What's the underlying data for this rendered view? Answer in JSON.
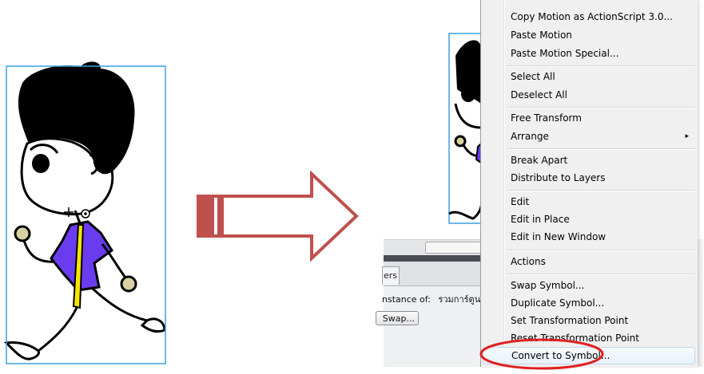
{
  "context_menu": {
    "items": [
      {
        "label": "Copy Motion as ActionScript 3.0...",
        "has_submenu": false
      },
      {
        "label": "Paste Motion",
        "has_submenu": false
      },
      {
        "label": "Paste Motion Special...",
        "has_submenu": false
      },
      {
        "label": "Select All",
        "has_submenu": false
      },
      {
        "label": "Deselect All",
        "has_submenu": false
      },
      {
        "label": "Free Transform",
        "has_submenu": false
      },
      {
        "label": "Arrange",
        "has_submenu": true
      },
      {
        "label": "Break Apart",
        "has_submenu": false
      },
      {
        "label": "Distribute to Layers",
        "has_submenu": false
      },
      {
        "label": "Edit",
        "has_submenu": false
      },
      {
        "label": "Edit in Place",
        "has_submenu": false
      },
      {
        "label": "Edit in New Window",
        "has_submenu": false
      },
      {
        "label": "Actions",
        "has_submenu": false
      },
      {
        "label": "Swap Symbol...",
        "has_submenu": false
      },
      {
        "label": "Duplicate Symbol...",
        "has_submenu": false
      },
      {
        "label": "Set Transformation Point",
        "has_submenu": false
      },
      {
        "label": "Reset Transformation Point",
        "has_submenu": false
      },
      {
        "label": "Convert to Symbol...",
        "has_submenu": false
      }
    ],
    "highlighted_item": "Convert to Symbol...",
    "submenu_glyph": "▸"
  },
  "properties_panel": {
    "tab_label": "ers",
    "instance_label": "nstance of:",
    "instance_value": "รวมการ์ตูน",
    "swap_button": "Swap..."
  },
  "colors": {
    "arrow_fill": "#c0504d",
    "annotation_ellipse": "#e02020",
    "selection_box": "#3aa0e0",
    "shirt": "#6a3cf0",
    "tie": "#f6e600"
  },
  "icons": {
    "transform_point": "crosshair-icon",
    "registration_point": "registration-point-icon",
    "submenu": "chevron-right-icon"
  }
}
